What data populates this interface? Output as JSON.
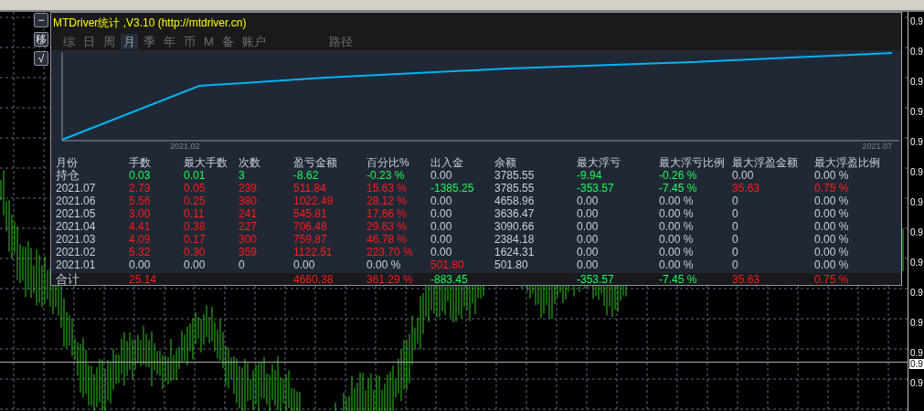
{
  "side_buttons": [
    "−",
    "移",
    "√"
  ],
  "panel": {
    "title": "MTDriver统计 ,V3.10 (http://mtdriver.cn)",
    "tabs": [
      {
        "label": "综",
        "selected": false
      },
      {
        "label": "日",
        "selected": false
      },
      {
        "label": "周",
        "selected": false
      },
      {
        "label": "月",
        "selected": true
      },
      {
        "label": "季",
        "selected": false
      },
      {
        "label": "年",
        "selected": false
      },
      {
        "label": "币",
        "selected": false
      },
      {
        "label": "M",
        "selected": false
      },
      {
        "label": "备",
        "selected": false
      },
      {
        "label": "账户",
        "selected": false
      }
    ],
    "extra_tabs": [
      {
        "label": "路径",
        "selected": false
      }
    ],
    "equity_chart": {
      "x_labels": [
        "2021.02",
        "2021.07"
      ]
    },
    "table": {
      "columns": [
        "月份",
        "手数",
        "最大手数",
        "次数",
        "盈亏金额",
        "百分比%",
        "出入金",
        "余额",
        "最大浮亏",
        "最大浮亏比例",
        "最大浮盈金额",
        "最大浮盈比例"
      ],
      "rows": [
        {
          "kind": "position",
          "cells": [
            {
              "text": "持仓"
            },
            {
              "text": "0.03",
              "color": "#1aff5a"
            },
            {
              "text": "0.01",
              "color": "#1aff5a"
            },
            {
              "text": "3",
              "color": "#1aff5a"
            },
            {
              "text": "-8.62",
              "color": "#1aff5a"
            },
            {
              "text": "-0.23 %",
              "color": "#1aff5a"
            },
            {
              "text": "0.00"
            },
            {
              "text": "3785.55"
            },
            {
              "text": "-9.94",
              "color": "#1aff5a"
            },
            {
              "text": "-0.26 %",
              "color": "#1aff5a"
            },
            {
              "text": "0.00"
            },
            {
              "text": "0.00 %"
            }
          ]
        },
        {
          "kind": "month",
          "cells": [
            {
              "text": "2021.07"
            },
            {
              "text": "2.73",
              "color": "#ff1a1a"
            },
            {
              "text": "0.05",
              "color": "#ff1a1a"
            },
            {
              "text": "239",
              "color": "#ff1a1a"
            },
            {
              "text": "511.84",
              "color": "#ff1a1a"
            },
            {
              "text": "15.63 %",
              "color": "#ff1a1a"
            },
            {
              "text": "-1385.25",
              "color": "#1aff5a"
            },
            {
              "text": "3785.55"
            },
            {
              "text": "-353.57",
              "color": "#1aff5a"
            },
            {
              "text": "-7.45 %",
              "color": "#1aff5a"
            },
            {
              "text": "35.63",
              "color": "#ff1a1a"
            },
            {
              "text": "0.75 %",
              "color": "#ff1a1a"
            }
          ]
        },
        {
          "kind": "month",
          "cells": [
            {
              "text": "2021.06"
            },
            {
              "text": "5.56",
              "color": "#ff1a1a"
            },
            {
              "text": "0.25",
              "color": "#ff1a1a"
            },
            {
              "text": "380",
              "color": "#ff1a1a"
            },
            {
              "text": "1022.49",
              "color": "#ff1a1a"
            },
            {
              "text": "28.12 %",
              "color": "#ff1a1a"
            },
            {
              "text": "0.00"
            },
            {
              "text": "4658.96"
            },
            {
              "text": "0.00"
            },
            {
              "text": "0.00 %"
            },
            {
              "text": "0"
            },
            {
              "text": "0.00 %"
            }
          ]
        },
        {
          "kind": "month",
          "cells": [
            {
              "text": "2021.05"
            },
            {
              "text": "3.00",
              "color": "#ff1a1a"
            },
            {
              "text": "0.11",
              "color": "#ff1a1a"
            },
            {
              "text": "241",
              "color": "#ff1a1a"
            },
            {
              "text": "545.81",
              "color": "#ff1a1a"
            },
            {
              "text": "17.66 %",
              "color": "#ff1a1a"
            },
            {
              "text": "0.00"
            },
            {
              "text": "3636.47"
            },
            {
              "text": "0.00"
            },
            {
              "text": "0.00 %"
            },
            {
              "text": "0"
            },
            {
              "text": "0.00 %"
            }
          ]
        },
        {
          "kind": "month",
          "cells": [
            {
              "text": "2021.04"
            },
            {
              "text": "4.41",
              "color": "#ff1a1a"
            },
            {
              "text": "0.38",
              "color": "#ff1a1a"
            },
            {
              "text": "227",
              "color": "#ff1a1a"
            },
            {
              "text": "706.48",
              "color": "#ff1a1a"
            },
            {
              "text": "29.63 %",
              "color": "#ff1a1a"
            },
            {
              "text": "0.00"
            },
            {
              "text": "3090.66"
            },
            {
              "text": "0.00"
            },
            {
              "text": "0.00 %"
            },
            {
              "text": "0"
            },
            {
              "text": "0.00 %"
            }
          ]
        },
        {
          "kind": "month",
          "cells": [
            {
              "text": "2021.03"
            },
            {
              "text": "4.09",
              "color": "#ff1a1a"
            },
            {
              "text": "0.17",
              "color": "#ff1a1a"
            },
            {
              "text": "300",
              "color": "#ff1a1a"
            },
            {
              "text": "759.87",
              "color": "#ff1a1a"
            },
            {
              "text": "46.78 %",
              "color": "#ff1a1a"
            },
            {
              "text": "0.00"
            },
            {
              "text": "2384.18"
            },
            {
              "text": "0.00"
            },
            {
              "text": "0.00 %"
            },
            {
              "text": "0"
            },
            {
              "text": "0.00 %"
            }
          ]
        },
        {
          "kind": "month",
          "cells": [
            {
              "text": "2021.02"
            },
            {
              "text": "5.32",
              "color": "#ff1a1a"
            },
            {
              "text": "0.30",
              "color": "#ff1a1a"
            },
            {
              "text": "359",
              "color": "#ff1a1a"
            },
            {
              "text": "1122.51",
              "color": "#ff1a1a"
            },
            {
              "text": "223.70 %",
              "color": "#ff1a1a"
            },
            {
              "text": "0.00"
            },
            {
              "text": "1624.31"
            },
            {
              "text": "0.00"
            },
            {
              "text": "0.00 %"
            },
            {
              "text": "0"
            },
            {
              "text": "0.00 %"
            }
          ]
        },
        {
          "kind": "month",
          "cells": [
            {
              "text": "2021.01"
            },
            {
              "text": "0.00"
            },
            {
              "text": "0.00"
            },
            {
              "text": "0"
            },
            {
              "text": "0.00"
            },
            {
              "text": "0.00 %"
            },
            {
              "text": "501.80",
              "color": "#ff1a1a"
            },
            {
              "text": "501.80"
            },
            {
              "text": "0.00"
            },
            {
              "text": "0.00 %"
            },
            {
              "text": "0"
            },
            {
              "text": "0.00 %"
            }
          ]
        },
        {
          "kind": "total",
          "cells": [
            {
              "text": "合计"
            },
            {
              "text": "25.14",
              "color": "#ff1a1a"
            },
            null,
            null,
            {
              "text": "4660.38",
              "color": "#ff1a1a"
            },
            {
              "text": "361.29 %",
              "color": "#ff1a1a"
            },
            {
              "text": "-883.45",
              "color": "#1aff5a"
            },
            null,
            {
              "text": "-353.57",
              "color": "#1aff5a"
            },
            {
              "text": "-7.45 %",
              "color": "#1aff5a"
            },
            {
              "text": "35.63",
              "color": "#ff1a1a"
            },
            {
              "text": "0.75 %",
              "color": "#ff1a1a"
            }
          ]
        }
      ]
    }
  },
  "price_axis": {
    "labels": [
      "0.9",
      "0.9",
      "0.9",
      "0.9",
      "0.9",
      "0.9",
      "0.9",
      "0.9",
      "0.9",
      "0.9",
      "0.9",
      "0.9",
      "0.9"
    ],
    "current_price": "0.9"
  }
}
